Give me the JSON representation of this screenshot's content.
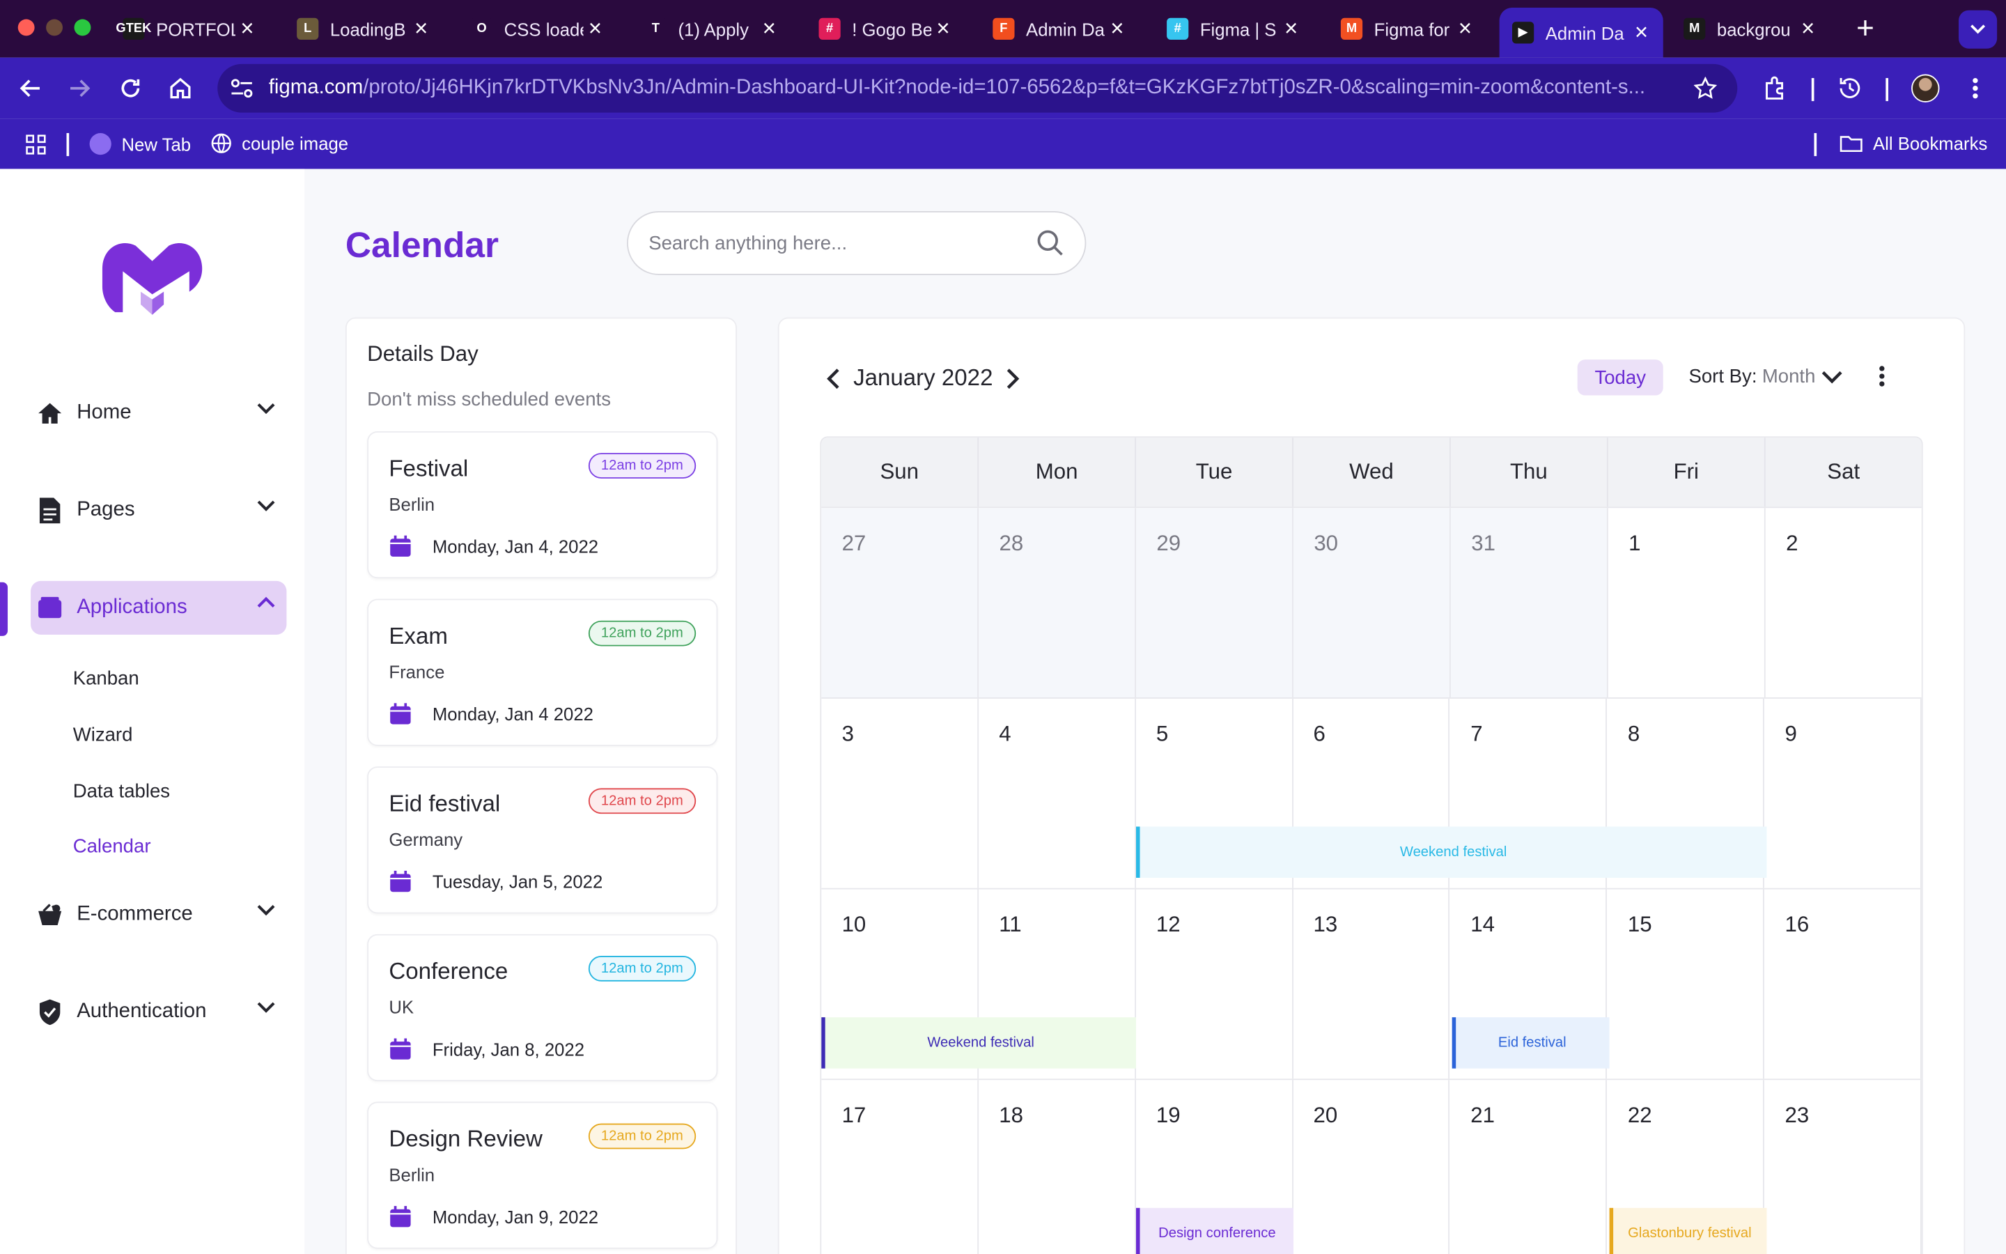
{
  "browser": {
    "tabs": [
      {
        "title": "PORTFOL",
        "fav": "GTEK",
        "fav_color": "#1a1a1a"
      },
      {
        "title": "LoadingB",
        "fav": "L",
        "fav_color": "#6b5b3a"
      },
      {
        "title": "CSS loade",
        "fav": "O",
        "fav_color": "#2a0a3e"
      },
      {
        "title": "(1) Apply",
        "fav": "T",
        "fav_color": "#2a0a3e"
      },
      {
        "title": "! Gogo Be",
        "fav": "#",
        "fav_color": "#e01e5a"
      },
      {
        "title": "Admin Da",
        "fav": "F",
        "fav_color": "#f24e1e"
      },
      {
        "title": "Figma | S",
        "fav": "#",
        "fav_color": "#36c5f0"
      },
      {
        "title": "Figma for",
        "fav": "M",
        "fav_color": "#f25022"
      },
      {
        "title": "Admin Da",
        "fav": "▶",
        "fav_color": "#1a1a1a"
      },
      {
        "title": "backgrou",
        "fav": "M",
        "fav_color": "#1a1a1a"
      }
    ],
    "url_host": "figma.com",
    "url_path": "/proto/Jj46HKjn7krDTVKbsNv3Jn/Admin-Dashboard-UI-Kit?node-id=107-6562&p=f&t=GKzKGFz7btTj0sZR-0&scaling=min-zoom&content-s...",
    "bookmarks": [
      "New Tab",
      "couple image"
    ],
    "all_bookmarks": "All Bookmarks"
  },
  "sidebar": {
    "nav": [
      {
        "label": "Home"
      },
      {
        "label": "Pages"
      },
      {
        "label": "Applications"
      },
      {
        "label": "E-commerce"
      },
      {
        "label": "Authentication"
      }
    ],
    "sub": [
      "Kanban",
      "Wizard",
      "Data tables",
      "Calendar"
    ]
  },
  "page": {
    "title": "Calendar",
    "search_placeholder": "Search anything here..."
  },
  "details": {
    "title": "Details Day",
    "subtitle": "Don't miss scheduled events",
    "events": [
      {
        "title": "Festival",
        "location": "Berlin",
        "time": "12am to 2pm",
        "date": "Monday, Jan 4, 2022",
        "color": "#7b3fe4",
        "bg": "#f3ecfd"
      },
      {
        "title": "Exam",
        "location": "France",
        "time": "12am to 2pm",
        "date": "Monday, Jan 4 2022",
        "color": "#3fa25b",
        "bg": "#ebf8ef"
      },
      {
        "title": "Eid festival",
        "location": "Germany",
        "time": "12am to 2pm",
        "date": "Tuesday, Jan 5, 2022",
        "color": "#e0474c",
        "bg": "#fdecec"
      },
      {
        "title": "Conference",
        "location": "UK",
        "time": "12am to 2pm",
        "date": "Friday, Jan 8, 2022",
        "color": "#23b5e0",
        "bg": "#eaf8fd"
      },
      {
        "title": "Design Review",
        "location": "Berlin",
        "time": "12am to 2pm",
        "date": "Monday, Jan 9, 2022",
        "color": "#e6a81f",
        "bg": "#fdf5e3"
      }
    ]
  },
  "calendar": {
    "month": "January 2022",
    "today": "Today",
    "sort_label": "Sort By:",
    "sort_value": "Month",
    "weekdays": [
      "Sun",
      "Mon",
      "Tue",
      "Wed",
      "Thu",
      "Fri",
      "Sat"
    ],
    "weeks": [
      [
        "27",
        "28",
        "29",
        "30",
        "31",
        "1",
        "2"
      ],
      [
        "3",
        "4",
        "5",
        "6",
        "7",
        "8",
        "9"
      ],
      [
        "10",
        "11",
        "12",
        "13",
        "14",
        "15",
        "16"
      ],
      [
        "17",
        "18",
        "19",
        "20",
        "21",
        "22",
        "23"
      ]
    ],
    "events": [
      {
        "label": "Weekend festival",
        "week": 1,
        "start": 2,
        "span": 4,
        "color": "#29b9e6",
        "bg": "#edf8fd"
      },
      {
        "label": "Weekend festival",
        "week": 2,
        "start": 0,
        "span": 2,
        "color": "#3d2bb5",
        "bg": "#eefbe9"
      },
      {
        "label": "Eid festival",
        "week": 2,
        "start": 4,
        "span": 1,
        "color": "#2b63d9",
        "bg": "#e8f1fd"
      },
      {
        "label": "Design conference",
        "week": 3,
        "start": 2,
        "span": 1,
        "color": "#6a2bd3",
        "bg": "#efe6fb"
      },
      {
        "label": "Glastonbury festival",
        "week": 3,
        "start": 5,
        "span": 1,
        "color": "#e6a81f",
        "bg": "#fdf4e0"
      }
    ]
  }
}
